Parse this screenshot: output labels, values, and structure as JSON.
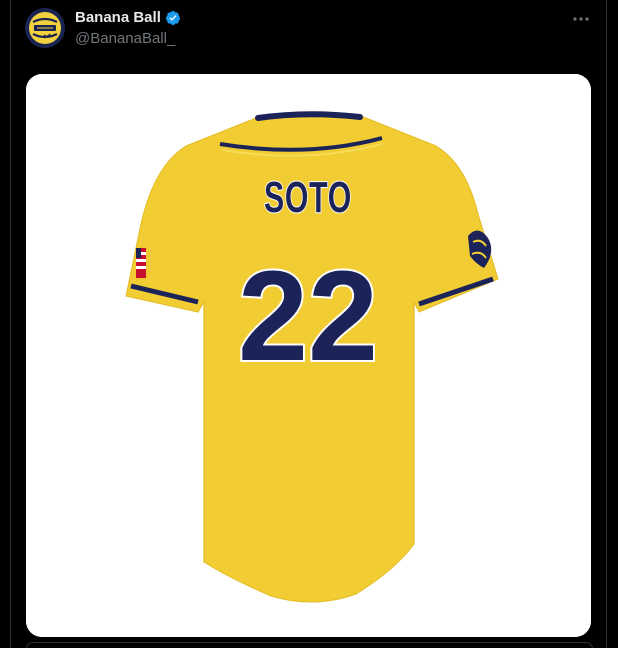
{
  "post": {
    "author": {
      "display_name": "Banana Ball",
      "handle": "@BananaBall_",
      "verified": true,
      "avatar_icon": "banana-ball-logo-icon"
    },
    "more_icon": "more-horizontal-icon",
    "media": {
      "jersey": {
        "player_name": "SOTO",
        "number": "22",
        "body_color": "#f1cc33",
        "trim_color": "#1c2358"
      }
    }
  },
  "colors": {
    "background": "#000000",
    "verified_blue": "#1d9bf0",
    "secondary_text": "#71767b",
    "primary_text": "#e7e9ea",
    "border": "#2f3336"
  }
}
